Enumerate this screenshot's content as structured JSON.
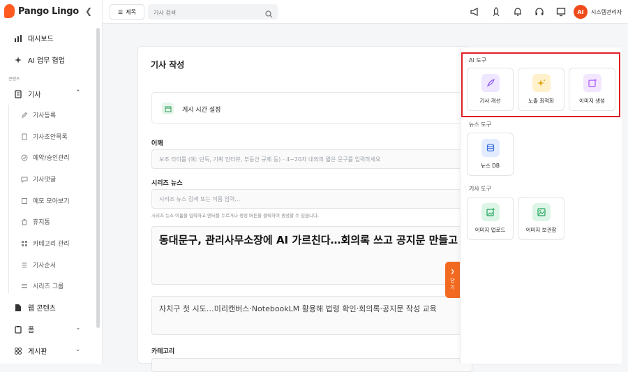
{
  "brand": {
    "name": "Pango Lingo"
  },
  "sidebar": {
    "top_items": [
      {
        "label": "대시보드",
        "icon": "bar-chart-icon"
      },
      {
        "label": "AI 업무 협업",
        "icon": "sparkle-icon"
      }
    ],
    "section_label": "콘텐츠",
    "article_group": {
      "label": "기사",
      "icon": "document-icon"
    },
    "sub_items": [
      {
        "label": "기사등록",
        "icon": "edit-icon"
      },
      {
        "label": "기사초안목록",
        "icon": "file-icon"
      },
      {
        "label": "예약/승인관리",
        "icon": "check-circle-icon"
      },
      {
        "label": "기사댓글",
        "icon": "comment-icon"
      },
      {
        "label": "메모 모아보기",
        "icon": "memo-icon"
      },
      {
        "label": "휴지통",
        "icon": "trash-icon"
      },
      {
        "label": "카테고리 관리",
        "icon": "grid-icon"
      },
      {
        "label": "기사순서",
        "icon": "list-icon"
      },
      {
        "label": "시리즈 그룹",
        "icon": "stack-icon"
      }
    ],
    "bottom_items": [
      {
        "label": "웹 콘텐츠",
        "icon": "document-icon"
      },
      {
        "label": "폼",
        "icon": "clipboard-icon"
      },
      {
        "label": "게시판",
        "icon": "board-icon"
      }
    ]
  },
  "topbar": {
    "title_button": "제목",
    "search_placeholder": "기사 검색",
    "user_initials": "AI",
    "user_name": "시스템관리자"
  },
  "editor": {
    "heading": "기사 작성",
    "schedule_label": "게시 시간 설정",
    "kicker_label": "어깨",
    "kicker_placeholder": "보조 타이틀 (예: 단독, 기획 인터뷰, 부동산 규제 등) - 4~20자 내외의 짧은 문구를 입력하세요",
    "series_label": "시리즈 뉴스",
    "series_placeholder": "시리즈 뉴스 검색 또는 이름 입력...",
    "series_help": "시리즈 뉴스 이름을 입력하고 엔터를 누르거나 생성 버튼을 클릭하여 생성할 수 있습니다.",
    "headline": "동대문구, 관리사무소장에 AI 가르친다…회의록 쓰고 공지문 만들고",
    "subheadline": "자치구 첫 시도…미리캔버스·NotebookLM 활용해 법령 확인·회의록·공지문 작성 교육",
    "category_label": "카테고리"
  },
  "close_tab": {
    "label_1": "닫",
    "label_2": "기"
  },
  "tools_panel": {
    "ai_group": "AI 도구",
    "ai_tools": [
      {
        "label": "기사 개선",
        "icon": "feather-icon",
        "bg": "#efe6ff",
        "color": "#8b5cf6"
      },
      {
        "label": "노출 최적화",
        "icon": "sparkles-icon",
        "bg": "#fff1cc",
        "color": "#e0a100"
      },
      {
        "label": "이미지 생성",
        "icon": "image-plus-icon",
        "bg": "#f3e6ff",
        "color": "#a855f7"
      }
    ],
    "news_group": "뉴스 도구",
    "news_tools": [
      {
        "label": "뉴스 DB",
        "icon": "database-icon",
        "bg": "#e3ecff",
        "color": "#3b6fe0"
      }
    ],
    "article_group": "기사 도구",
    "article_tools": [
      {
        "label": "이미지 업로드",
        "icon": "image-upload-icon",
        "bg": "#ddf5e6",
        "color": "#22a45d"
      },
      {
        "label": "이미지 보관함",
        "icon": "image-library-icon",
        "bg": "#ddf5e6",
        "color": "#22a45d"
      }
    ]
  },
  "colors": {
    "accent": "#ef4b1a",
    "highlight": "#e01f26"
  }
}
